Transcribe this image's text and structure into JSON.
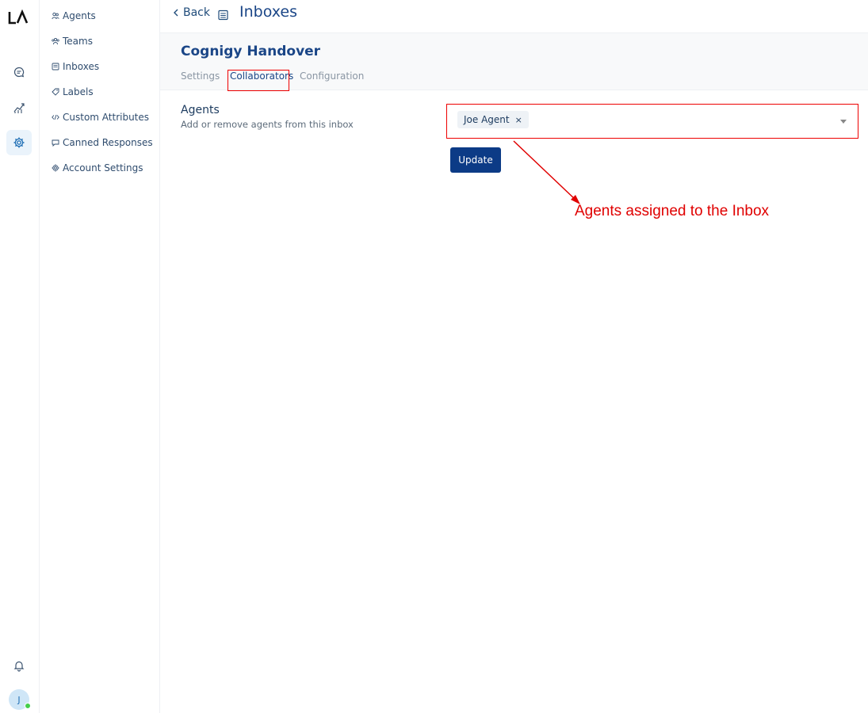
{
  "app": {
    "logo_text": "LA",
    "user_initial": "J"
  },
  "rail": {
    "items": [
      {
        "icon": "chat-bubble-icon",
        "active": false
      },
      {
        "icon": "reports-chart-icon",
        "active": false
      },
      {
        "icon": "gear-icon",
        "active": true
      },
      {
        "icon": "bell-icon",
        "active": false
      }
    ]
  },
  "sidebar": {
    "items": [
      {
        "label": "Agents",
        "icon": "agents-icon"
      },
      {
        "label": "Teams",
        "icon": "teams-icon"
      },
      {
        "label": "Inboxes",
        "icon": "inbox-icon"
      },
      {
        "label": "Labels",
        "icon": "tag-icon"
      },
      {
        "label": "Custom Attributes",
        "icon": "code-icon"
      },
      {
        "label": "Canned Responses",
        "icon": "message-icon"
      },
      {
        "label": "Account Settings",
        "icon": "gear-icon"
      }
    ]
  },
  "header": {
    "back_label": "Back",
    "title": "Inboxes"
  },
  "inbox": {
    "name": "Cognigy Handover",
    "tabs": [
      {
        "label": "Settings",
        "active": false
      },
      {
        "label": "Collaborators",
        "active": true
      },
      {
        "label": "Configuration",
        "active": false
      }
    ]
  },
  "agents_section": {
    "title": "Agents",
    "description": "Add or remove agents from this inbox",
    "selected_agents": [
      "Joe Agent"
    ],
    "remove_glyph": "×",
    "update_label": "Update"
  },
  "annotation": {
    "text": "Agents assigned to the Inbox",
    "color": "#e00000"
  },
  "colors": {
    "primary": "#0c3b86",
    "title": "#1b4687",
    "highlight": "#ee0000",
    "online": "#44ce4b"
  }
}
